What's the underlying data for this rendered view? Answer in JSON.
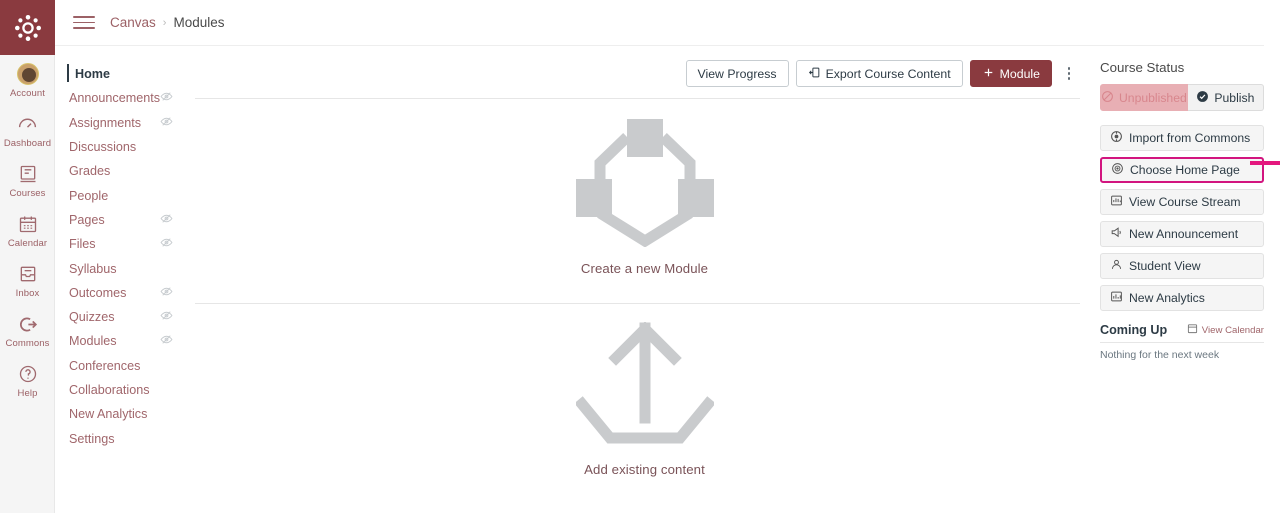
{
  "global_nav": {
    "logo_name": "canvas-logo",
    "items": [
      {
        "label": "Account",
        "icon": "avatar-icon"
      },
      {
        "label": "Dashboard",
        "icon": "dashboard-icon"
      },
      {
        "label": "Courses",
        "icon": "courses-icon"
      },
      {
        "label": "Calendar",
        "icon": "calendar-icon"
      },
      {
        "label": "Inbox",
        "icon": "inbox-icon"
      },
      {
        "label": "Commons",
        "icon": "commons-icon"
      },
      {
        "label": "Help",
        "icon": "help-icon"
      }
    ]
  },
  "header": {
    "menu_icon": "hamburger-icon",
    "breadcrumb": {
      "root": "Canvas",
      "separator": "›",
      "current": "Modules"
    }
  },
  "course_nav": {
    "items": [
      {
        "label": "Home",
        "active": true,
        "hidden_icon": false
      },
      {
        "label": "Announcements",
        "active": false,
        "hidden_icon": true
      },
      {
        "label": "Assignments",
        "active": false,
        "hidden_icon": true
      },
      {
        "label": "Discussions",
        "active": false,
        "hidden_icon": false
      },
      {
        "label": "Grades",
        "active": false,
        "hidden_icon": false
      },
      {
        "label": "People",
        "active": false,
        "hidden_icon": false
      },
      {
        "label": "Pages",
        "active": false,
        "hidden_icon": true
      },
      {
        "label": "Files",
        "active": false,
        "hidden_icon": true
      },
      {
        "label": "Syllabus",
        "active": false,
        "hidden_icon": false
      },
      {
        "label": "Outcomes",
        "active": false,
        "hidden_icon": true
      },
      {
        "label": "Quizzes",
        "active": false,
        "hidden_icon": true
      },
      {
        "label": "Modules",
        "active": false,
        "hidden_icon": true
      },
      {
        "label": "Conferences",
        "active": false,
        "hidden_icon": false
      },
      {
        "label": "Collaborations",
        "active": false,
        "hidden_icon": false
      },
      {
        "label": "New Analytics",
        "active": false,
        "hidden_icon": false
      },
      {
        "label": "Settings",
        "active": false,
        "hidden_icon": false
      }
    ]
  },
  "toolbar": {
    "view_progress": "View Progress",
    "export_course_content": "Export Course Content",
    "export_icon": "export-icon",
    "add_module": "Module",
    "add_module_icon": "plus-icon",
    "more_icon": "kebab-menu-icon"
  },
  "main": {
    "create_module": {
      "caption": "Create a new Module",
      "icon": "module-placeholder-icon"
    },
    "add_existing": {
      "caption": "Add existing content",
      "icon": "upload-arrow-icon"
    }
  },
  "sidebar": {
    "course_status_title": "Course Status",
    "unpublished_label": "Unpublished",
    "unpublished_icon": "no-entry-icon",
    "publish_label": "Publish",
    "publish_icon": "check-circle-icon",
    "buttons": [
      {
        "label": "Import from Commons",
        "icon": "commons-icon",
        "highlight": false
      },
      {
        "label": "Choose Home Page",
        "icon": "target-icon",
        "highlight": true
      },
      {
        "label": "View Course Stream",
        "icon": "stream-icon",
        "highlight": false
      },
      {
        "label": "New Announcement",
        "icon": "announcement-icon",
        "highlight": false
      },
      {
        "label": "Student View",
        "icon": "student-view-icon",
        "highlight": false
      },
      {
        "label": "New Analytics",
        "icon": "analytics-icon",
        "highlight": false
      }
    ],
    "coming_up_title": "Coming Up",
    "view_calendar": "View Calendar",
    "view_calendar_icon": "calendar-icon",
    "nothing_text": "Nothing for the next week"
  },
  "annotation": {
    "arrow_icon": "annotation-arrow-icon",
    "arrow_color": "#e4177e",
    "highlight_color": "#d2157f"
  }
}
